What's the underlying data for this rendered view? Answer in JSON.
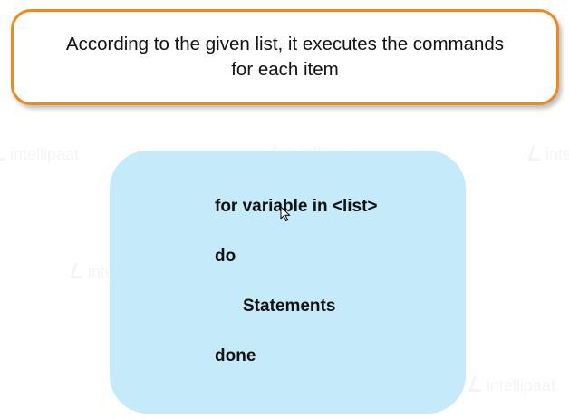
{
  "callout": {
    "line1": "According to the given list, it executes the commands",
    "line2": "for each item"
  },
  "syntax": {
    "line1": "for variable in <list>",
    "line2": "do",
    "line3": "Statements",
    "line4": "done"
  },
  "colors": {
    "callout_border": "#ef8a1a",
    "panel_fill": "#c5ebfb",
    "text": "#111111"
  },
  "icons": {
    "pointer": "mouse-cursor-icon"
  }
}
